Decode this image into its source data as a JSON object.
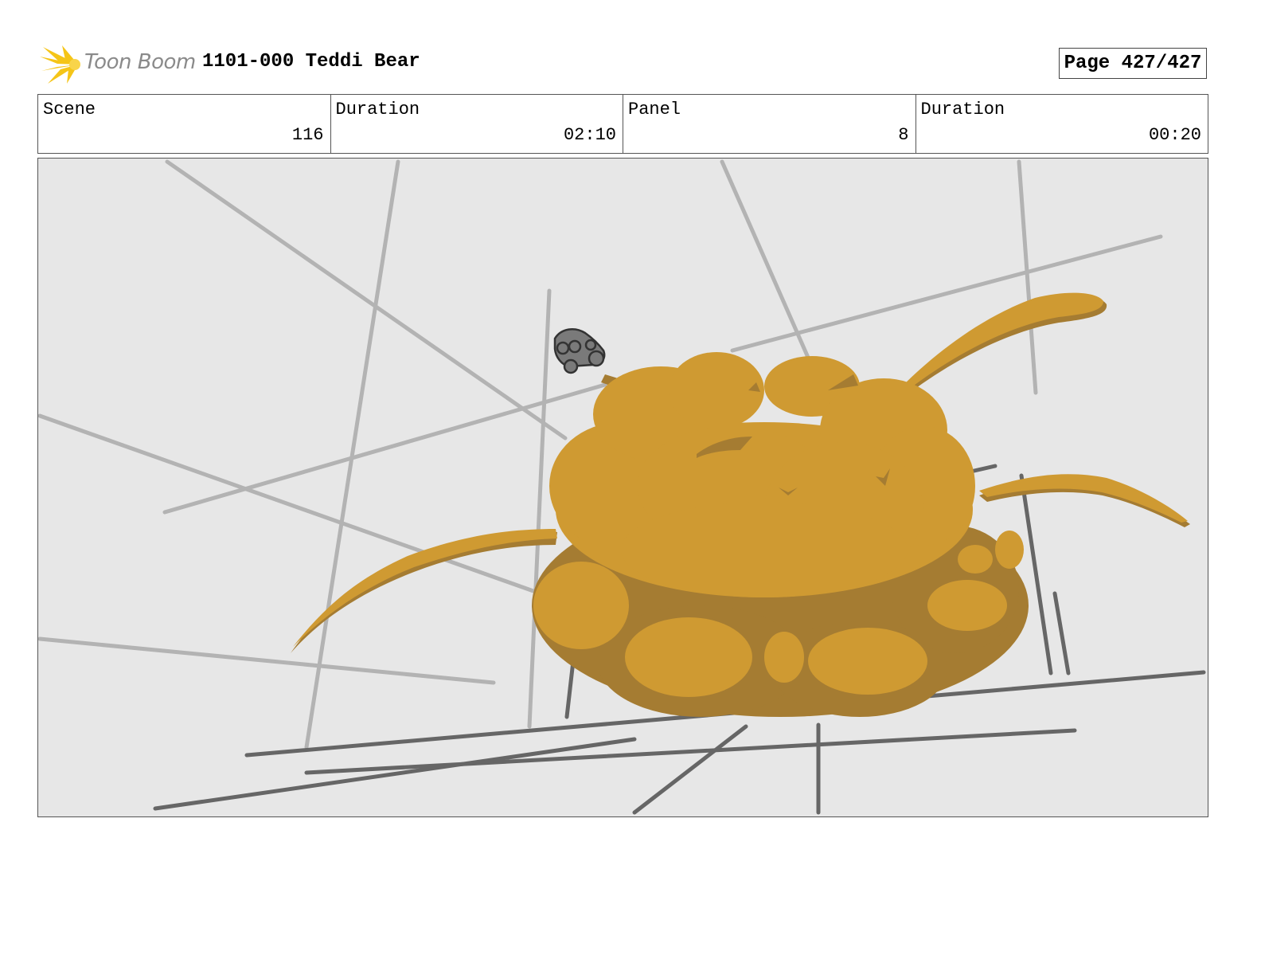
{
  "header": {
    "logo_text": "Toon Boom",
    "project_title": "1101-000 Teddi Bear",
    "page_label": "Page 427/427"
  },
  "info": {
    "scene_label": "Scene",
    "scene_value": "116",
    "scene_duration_label": "Duration",
    "scene_duration_value": "02:10",
    "panel_label": "Panel",
    "panel_value": "8",
    "panel_duration_label": "Duration",
    "panel_duration_value": "00:20"
  },
  "colors": {
    "logo_yellow": "#f5c518",
    "panel_background": "#e7e7e7",
    "light_lines": "#b3b3b3",
    "dark_lines": "#666666",
    "explosion_main": "#cf9a32",
    "explosion_shadow": "#a57c32",
    "vehicle": "#7a7a7a"
  }
}
